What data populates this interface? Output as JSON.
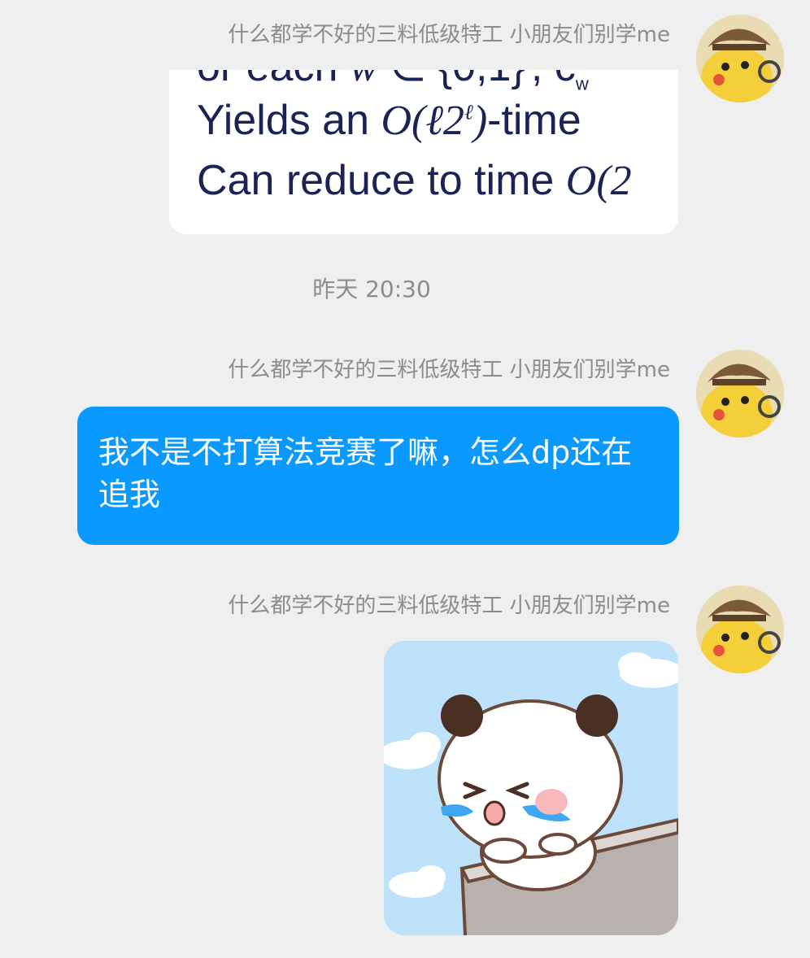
{
  "messages": [
    {
      "sender": "什么都学不好的三料低级特工 小朋友们别学me",
      "type": "image",
      "image_lines": [
        "Yields an",
        "-time",
        "Can reduce to time"
      ]
    },
    {
      "type": "timestamp",
      "text": "昨天 20:30"
    },
    {
      "sender": "什么都学不好的三料低级特工 小朋友们别学me",
      "type": "text",
      "text": "我不是不打算法竞赛了嘛，怎么dp还在追我"
    },
    {
      "sender": "什么都学不好的三料低级特工 小朋友们别学me",
      "type": "sticker",
      "sticker": "crying-panda-sticker"
    }
  ],
  "colors": {
    "background": "#efefef",
    "bubble_blue": "#0a99ff",
    "sender_text": "#8c8c8c"
  }
}
